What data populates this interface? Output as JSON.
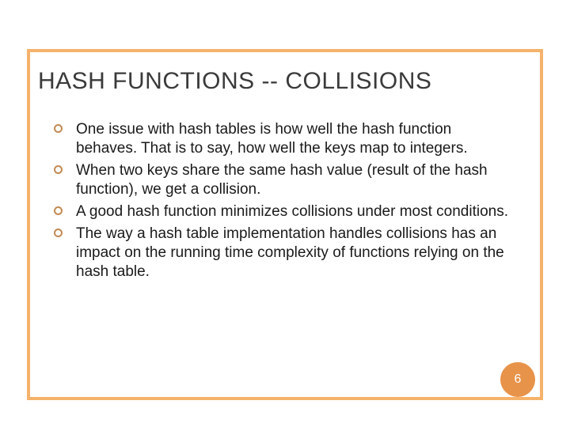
{
  "slide": {
    "title": "HASH FUNCTIONS -- COLLISIONS",
    "bullets": [
      "One issue with hash tables is how well the hash function behaves. That is to say, how well the keys map to integers.",
      "When two keys share the same hash value (result of the hash function), we get a collision.",
      "A good hash function minimizes collisions under most conditions.",
      "The way a hash table implementation handles collisions has an impact on the running time complexity of functions relying on the hash table."
    ],
    "page_number": "6"
  },
  "colors": {
    "frame_border": "#f6b26b",
    "bullet_ring": "#c28a54",
    "badge_bg": "#e8934a"
  }
}
